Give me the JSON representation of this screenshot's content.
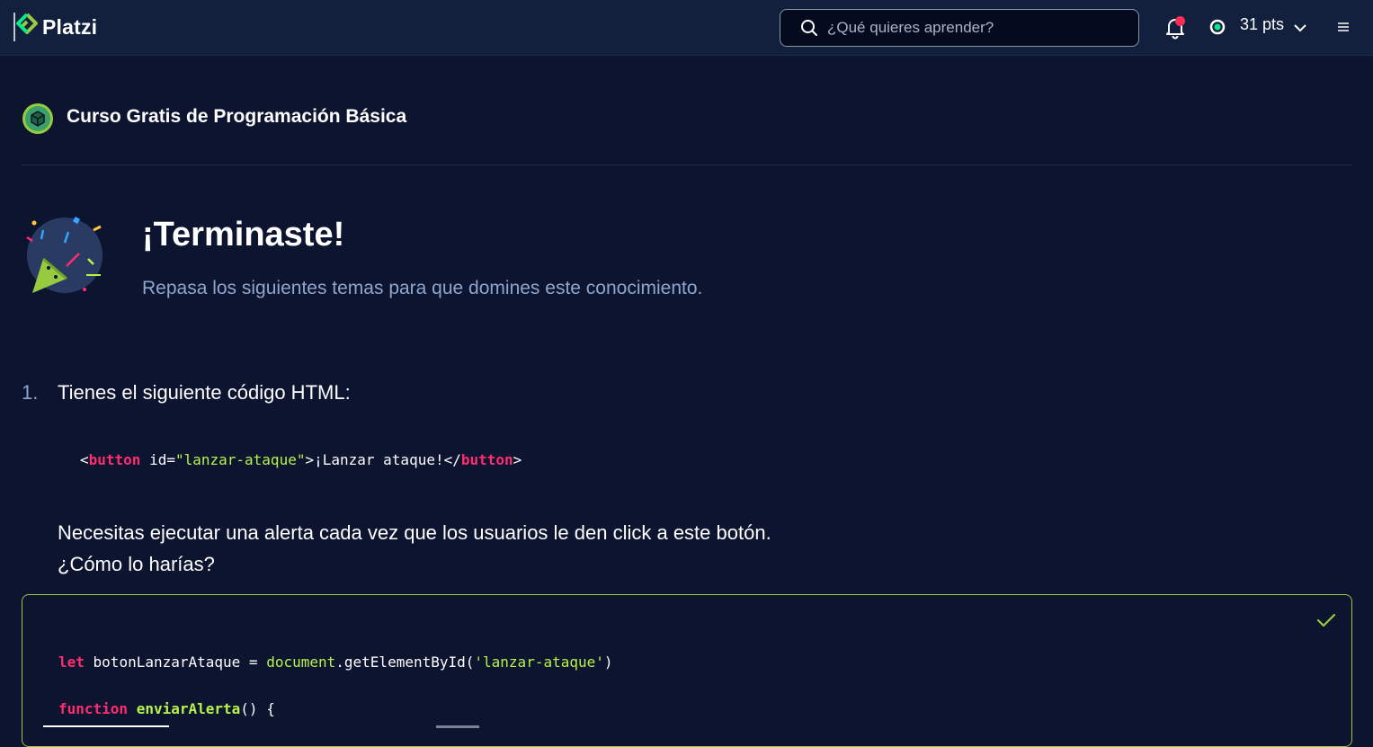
{
  "header": {
    "logo_text": "Platzi",
    "search_placeholder": "¿Qué quieres aprender?",
    "points": "31 pts",
    "brand_color": "#98ca3f"
  },
  "course": {
    "title": "Curso Gratis de Programación Básica"
  },
  "result": {
    "title": "¡Terminaste!",
    "subtitle": "Repasa los siguientes temas para que domines este conocimiento."
  },
  "question": {
    "number": "1.",
    "text": "Tienes el siguiente código HTML:",
    "html_code": {
      "open_lt": "<",
      "open_tag": "button",
      "attr": " id=",
      "attr_value": "\"lanzar-ataque\"",
      "text": ">¡Lanzar ataque!</",
      "close_tag": "button",
      "close_gt": ">"
    },
    "description_line1": "Necesitas ejecutar una alerta cada vez que los usuarios le den click a este botón.",
    "description_line2": "¿Cómo lo harías?"
  },
  "answer": {
    "line1": {
      "kw": "let",
      "var": " botonLanzarAtaque = ",
      "obj": "document",
      "method": ".getElementById(",
      "str": "'lanzar-ataque'",
      "end": ")"
    },
    "line2": {
      "kw": "function",
      "space": " ",
      "fn": "enviarAlerta",
      "end": "() {"
    },
    "status": "correct"
  },
  "icons": [
    "platzi-logo",
    "search-icon",
    "bell-icon",
    "points-icon",
    "chevron-down-icon",
    "menu-icon",
    "course-badge-icon",
    "party-popper-icon",
    "check-icon"
  ]
}
